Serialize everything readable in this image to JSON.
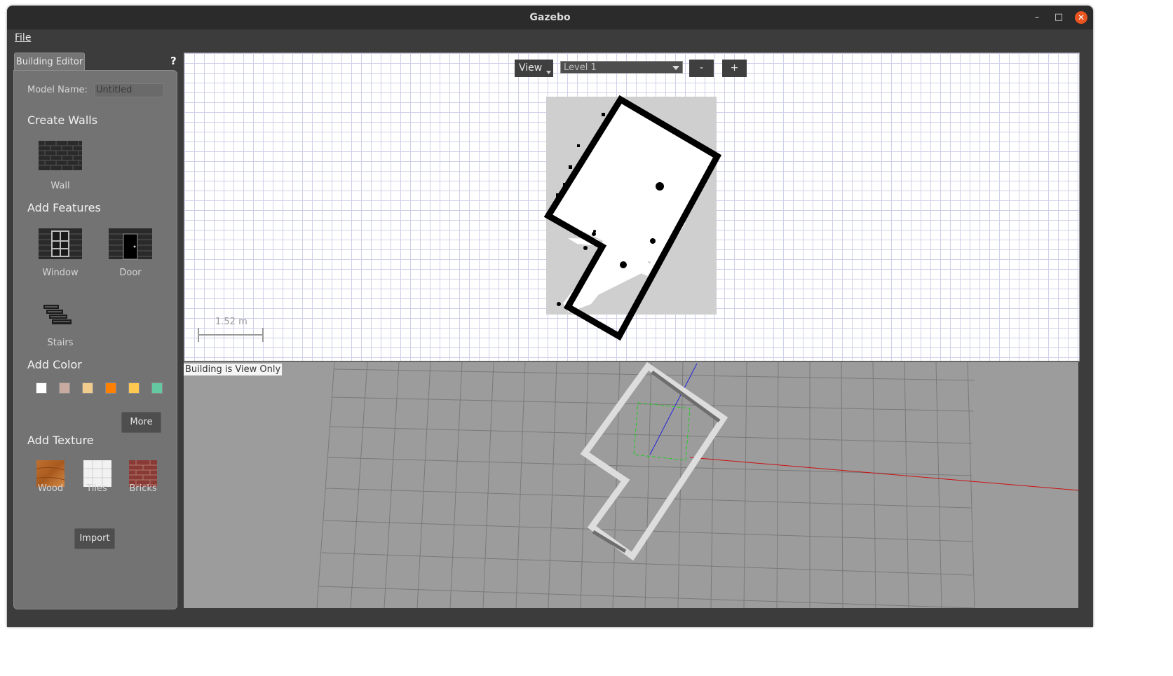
{
  "window": {
    "title": "Gazebo",
    "minimize": "–",
    "maximize": "□",
    "close": "✕"
  },
  "menu": {
    "file": "File"
  },
  "editor": {
    "tab_label": "Building Editor",
    "help": "?",
    "model_name_label": "Model Name:",
    "model_name_value": "Untitled",
    "create_walls": "Create Walls",
    "wall": "Wall",
    "add_features": "Add Features",
    "window": "Window",
    "door": "Door",
    "stairs": "Stairs",
    "add_color": "Add Color",
    "colors": [
      "#ffffff",
      "#c8aba0",
      "#f2cc8c",
      "#ff8000",
      "#ffc850",
      "#64c8a0"
    ],
    "more": "More",
    "add_texture": "Add Texture",
    "wood": "Wood",
    "tiles": "Tiles",
    "bricks": "Bricks",
    "import": "Import"
  },
  "view2d": {
    "view_button": "View",
    "level": "Level 1",
    "zoom_out": "-",
    "zoom_in": "+",
    "scale_label": "1.52 m"
  },
  "view3d": {
    "status": "Building is View Only"
  }
}
